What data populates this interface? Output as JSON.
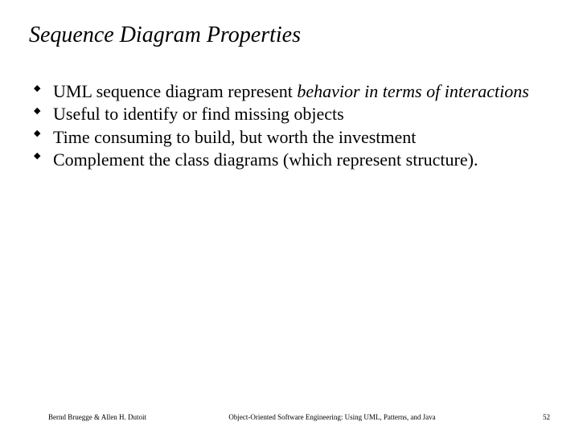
{
  "title": "Sequence Diagram Properties",
  "bullets": [
    {
      "plain": "UML sequence diagram represent ",
      "italic": "behavior in terms of interactions"
    },
    {
      "plain": "Useful to identify or find missing objects",
      "italic": ""
    },
    {
      "plain": "Time consuming to build, but worth the investment",
      "italic": ""
    },
    {
      "plain": "Complement the class diagrams (which represent structure).",
      "italic": ""
    }
  ],
  "bullet_glyph": "◆",
  "footer": {
    "left": "Bernd Bruegge & Allen H. Dutoit",
    "center": "Object-Oriented Software Engineering: Using UML, Patterns, and Java",
    "right": "52"
  }
}
